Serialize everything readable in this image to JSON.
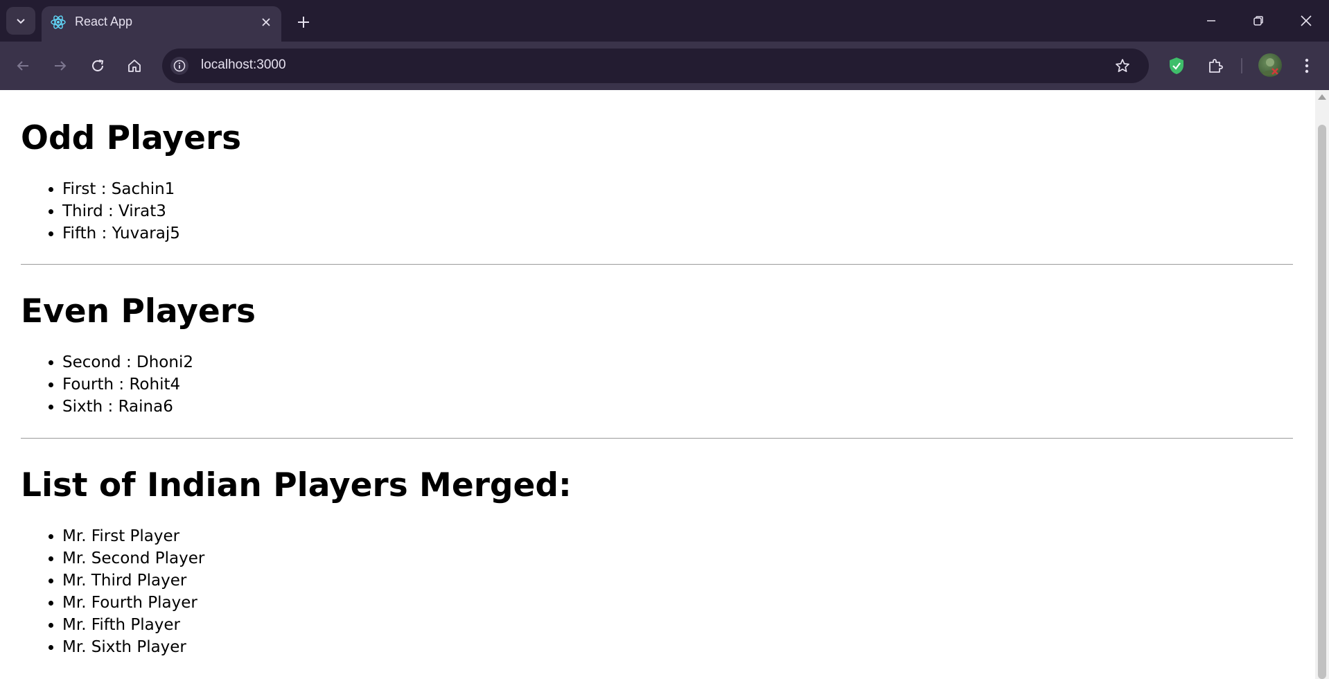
{
  "browser": {
    "tab_title": "React App",
    "url": "localhost:3000"
  },
  "page": {
    "odd_heading": "Odd Players",
    "odd_players": [
      "First : Sachin1",
      "Third : Virat3",
      "Fifth : Yuvaraj5"
    ],
    "even_heading": "Even Players",
    "even_players": [
      "Second : Dhoni2",
      "Fourth : Rohit4",
      "Sixth : Raina6"
    ],
    "merged_heading": "List of Indian Players Merged:",
    "merged_players": [
      "Mr. First Player",
      "Mr. Second Player",
      "Mr. Third Player",
      "Mr. Fourth Player",
      "Mr. Fifth Player",
      "Mr. Sixth Player"
    ]
  },
  "colors": {
    "tabbar": "#231c31",
    "toolbar": "#3a334a",
    "shield_green": "#3fbe6a"
  }
}
